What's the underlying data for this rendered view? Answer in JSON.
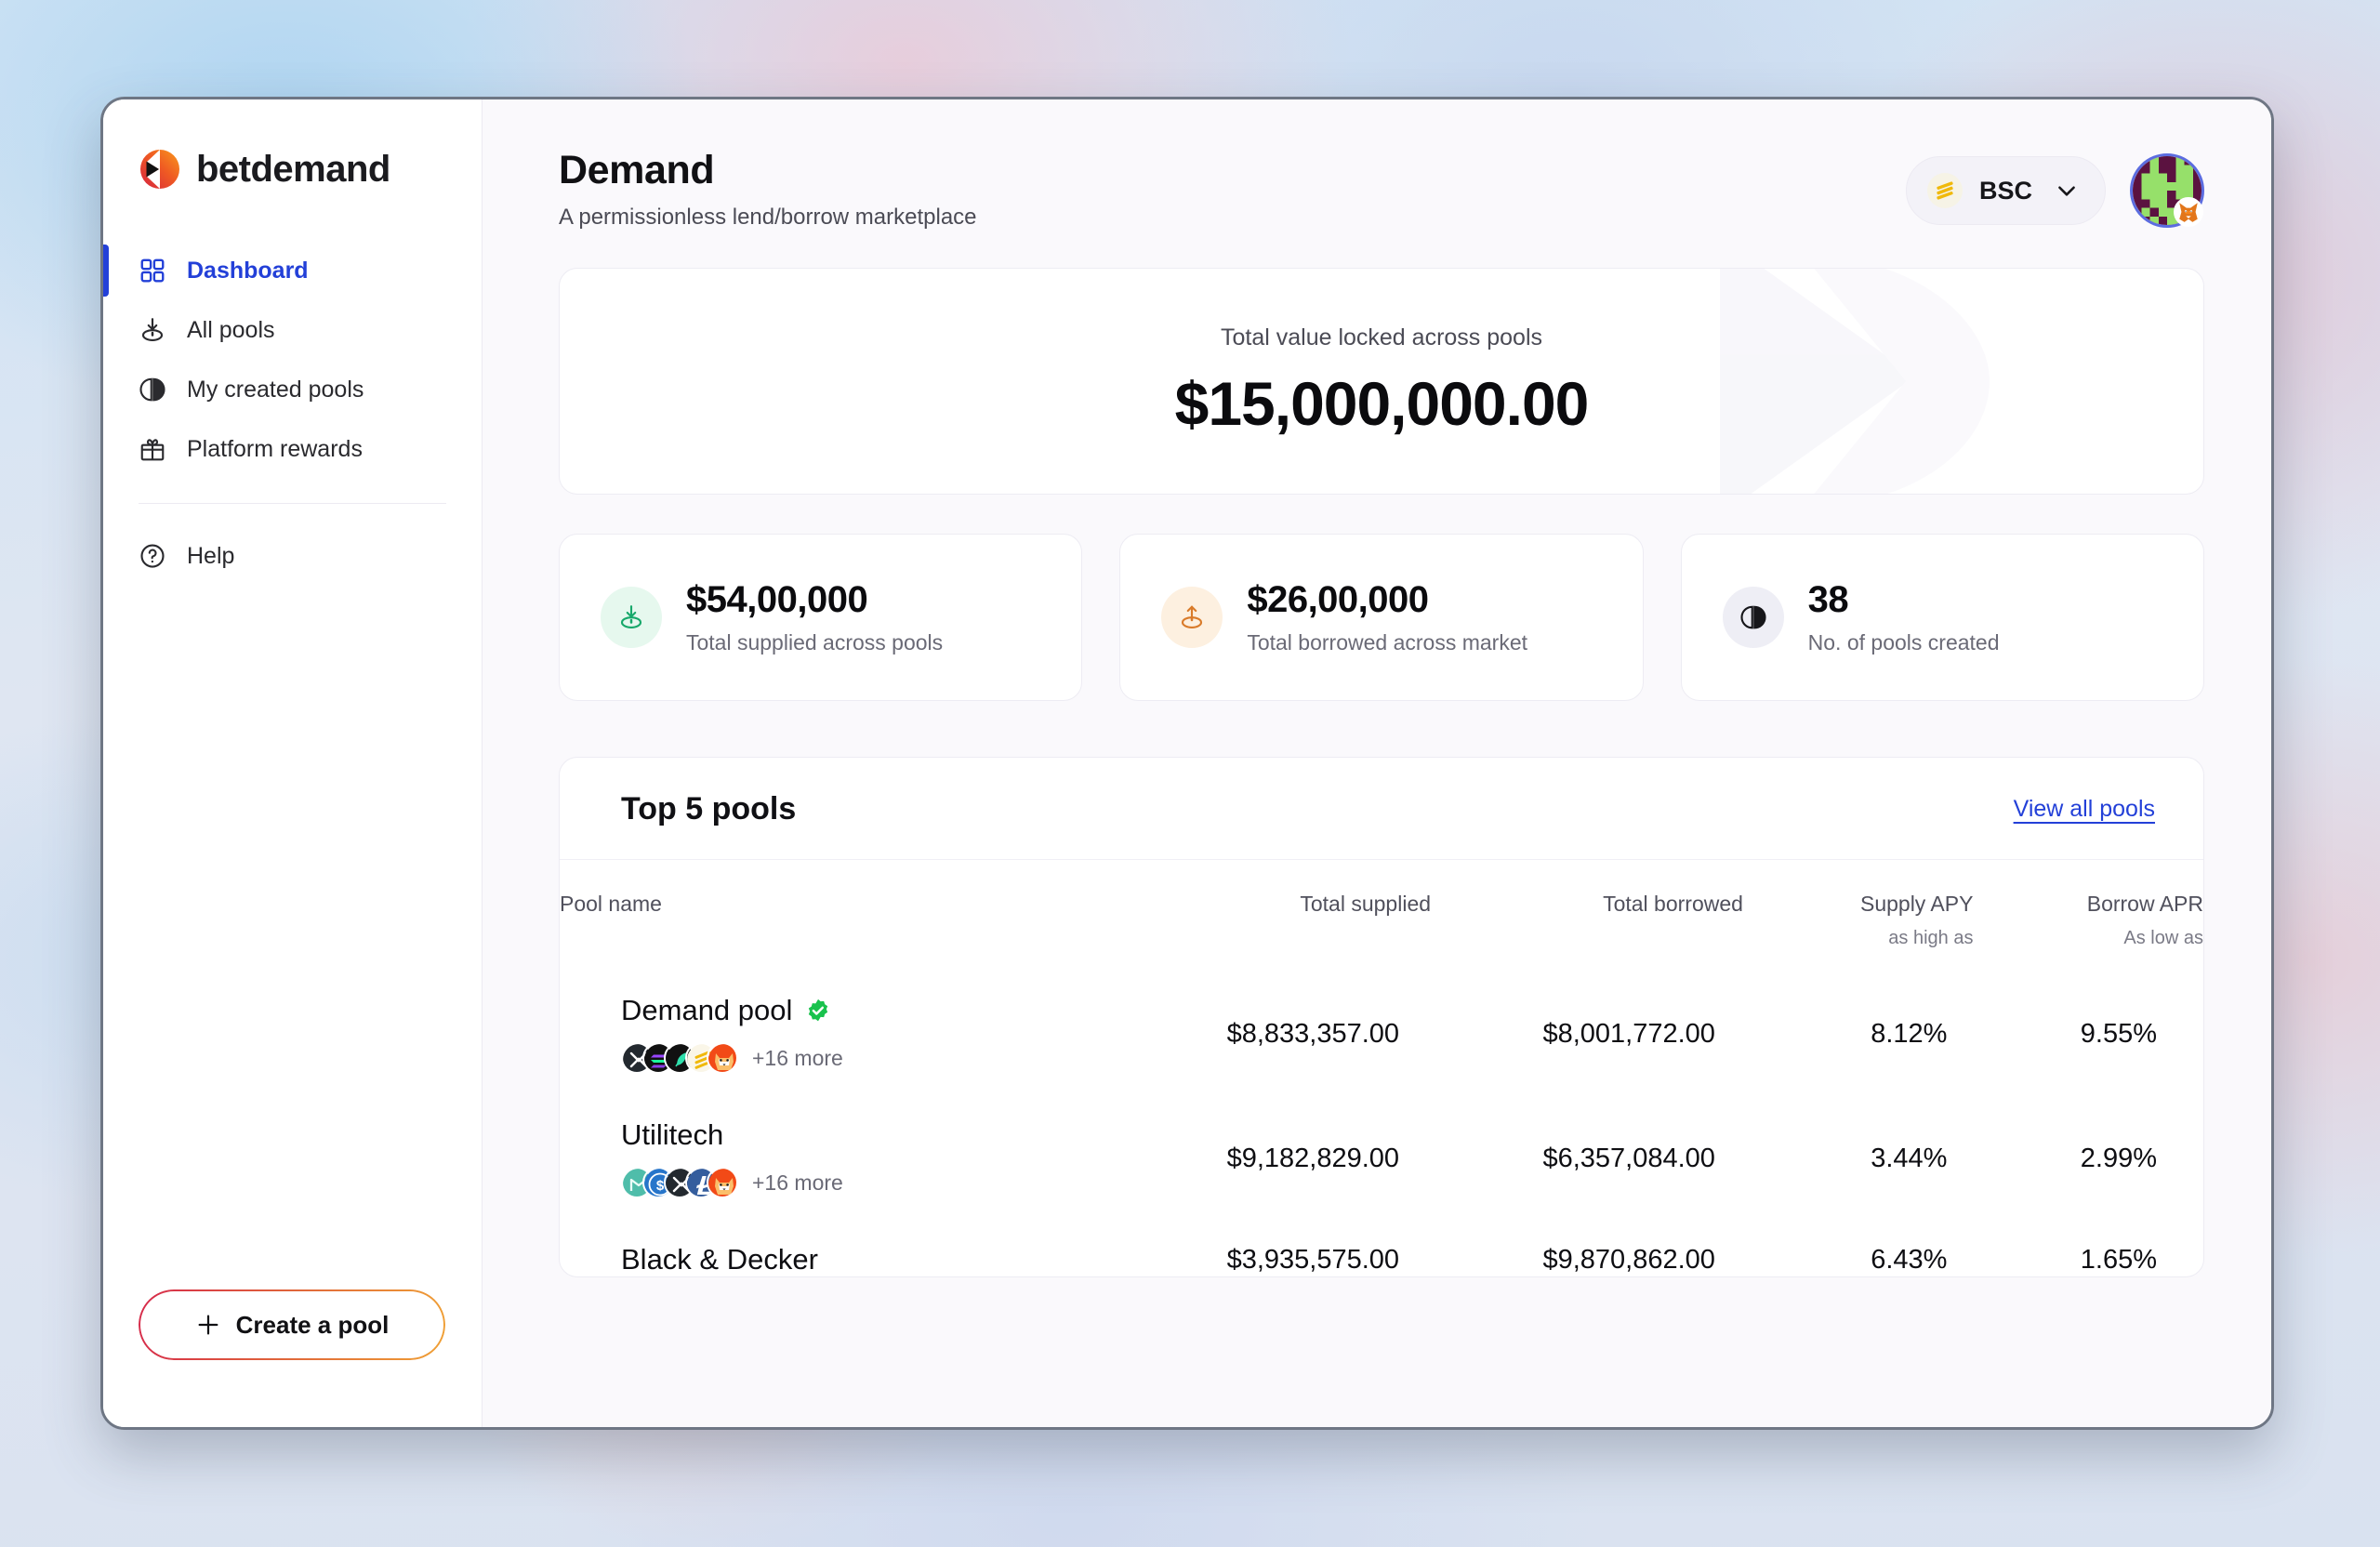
{
  "brand": {
    "name": "betdemand",
    "mark": "betdemand-logo"
  },
  "sidebar": {
    "items": [
      {
        "label": "Dashboard",
        "icon": "grid-icon",
        "active": true
      },
      {
        "label": "All pools",
        "icon": "supply-down-icon",
        "active": false
      },
      {
        "label": "My created pools",
        "icon": "pool-split-icon",
        "active": false
      },
      {
        "label": "Platform rewards",
        "icon": "gift-icon",
        "active": false
      }
    ],
    "help": {
      "label": "Help",
      "icon": "question-circle-icon"
    },
    "create_pool": {
      "label": "Create a pool",
      "icon": "plus-icon"
    }
  },
  "header": {
    "title": "Demand",
    "subtitle": "A permissionless lend/borrow marketplace",
    "chain": {
      "label": "BSC",
      "icon": "bnb-icon",
      "chevron": "chevron-down-icon"
    },
    "avatar": {
      "name": "wallet-avatar",
      "badge": "metamask-fox-icon"
    }
  },
  "tvl": {
    "label": "Total value locked across pools",
    "value": "$15,000,000.00"
  },
  "stats": [
    {
      "value": "$54,00,000",
      "label": "Total supplied across pools",
      "icon": "supply-down-icon",
      "tone": "green"
    },
    {
      "value": "$26,00,000",
      "label": "Total borrowed across market",
      "icon": "borrow-up-icon",
      "tone": "orange"
    },
    {
      "value": "38",
      "label": "No. of pools created",
      "icon": "pool-split-icon",
      "tone": "gray"
    }
  ],
  "pools": {
    "title": "Top 5 pools",
    "view_all": "View all pools",
    "columns": {
      "name": "Pool name",
      "supplied": "Total supplied",
      "borrowed": "Total borrowed",
      "supply_apy": "Supply APY",
      "supply_apy_sub": "as high as",
      "borrow_apr": "Borrow APR",
      "borrow_apr_sub": "As low as"
    },
    "rows": [
      {
        "name": "Demand pool",
        "verified": true,
        "tokens": [
          "xrp",
          "solana",
          "leaf",
          "bnb",
          "shiba"
        ],
        "more": "+16 more",
        "supplied": "$8,833,357.00",
        "borrowed": "$8,001,772.00",
        "supply_apy": "8.12%",
        "borrow_apr": "9.55%"
      },
      {
        "name": "Utilitech",
        "verified": false,
        "tokens": [
          "maker",
          "usdc",
          "xrp",
          "litecoin",
          "shiba"
        ],
        "more": "+16 more",
        "supplied": "$9,182,829.00",
        "borrowed": "$6,357,084.00",
        "supply_apy": "3.44%",
        "borrow_apr": "2.99%"
      },
      {
        "name": "Black & Decker",
        "verified": false,
        "tokens": [],
        "more": "",
        "supplied": "$3,935,575.00",
        "borrowed": "$9,870,862.00",
        "supply_apy": "6.43%",
        "borrow_apr": "1.65%"
      }
    ]
  },
  "colors": {
    "accent_blue": "#2340d8",
    "green": "#17a86a",
    "orange": "#d97b2a",
    "gradient_start": "#d6294b",
    "gradient_end": "#f0a135"
  }
}
